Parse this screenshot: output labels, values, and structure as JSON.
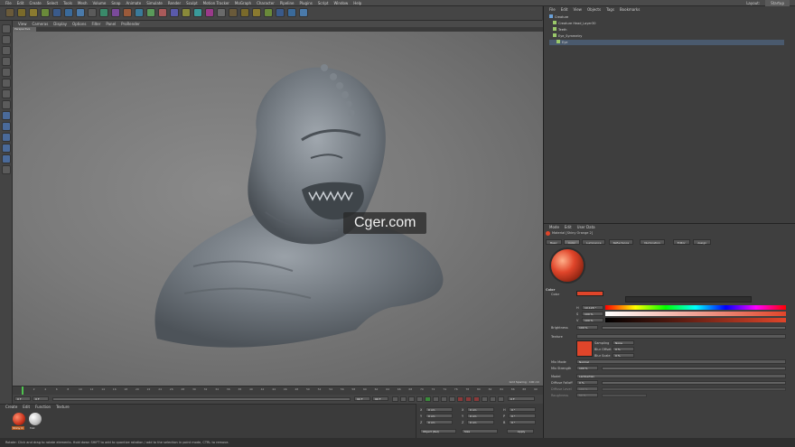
{
  "menubar": {
    "items": [
      "File",
      "Edit",
      "Create",
      "Select",
      "Tools",
      "Mesh",
      "Volume",
      "Snap",
      "Animate",
      "Simulate",
      "Render",
      "Sculpt",
      "Motion Tracker",
      "MoGraph",
      "Character",
      "Pipeline",
      "Plugins",
      "Script",
      "Window",
      "Help"
    ],
    "layout_label": "Layout:",
    "layout_value": "Startup"
  },
  "viewport": {
    "menu": [
      "View",
      "Cameras",
      "Display",
      "Options",
      "Filter",
      "Panel",
      "ProRender"
    ],
    "tag": "Perspective",
    "grid_spacing": "Grid Spacing : 100 cm",
    "watermark": "Cger.com"
  },
  "timeline": {
    "ticks": [
      "0",
      "2",
      "4",
      "6",
      "8",
      "10",
      "12",
      "14",
      "16",
      "18",
      "20",
      "22",
      "24",
      "26",
      "28",
      "30",
      "32",
      "34",
      "36",
      "38",
      "40",
      "42",
      "44",
      "46",
      "48",
      "50",
      "52",
      "54",
      "56",
      "58",
      "60",
      "62",
      "64",
      "66",
      "68",
      "70",
      "72",
      "74",
      "76",
      "78",
      "80",
      "82",
      "84",
      "86",
      "88",
      "90"
    ],
    "current": "0 F",
    "start": "0 F",
    "end": "90 F",
    "end2": "90 F",
    "right_field": "0 F"
  },
  "material_manager": {
    "menu": [
      "Create",
      "Edit",
      "Function",
      "Texture"
    ],
    "materials": [
      "Shiny O",
      "Mat"
    ]
  },
  "coordinates": {
    "rows": [
      {
        "a": "X",
        "av": "0 cm",
        "b": "X",
        "bv": "0 cm",
        "c": "H",
        "cv": "0 °"
      },
      {
        "a": "Y",
        "av": "0 cm",
        "b": "Y",
        "bv": "0 cm",
        "c": "P",
        "cv": "0 °"
      },
      {
        "a": "Z",
        "av": "0 cm",
        "b": "Z",
        "bv": "0 cm",
        "c": "B",
        "cv": "0 °"
      }
    ],
    "mode": "Object (Rel)",
    "size_mode": "Size",
    "apply": "Apply"
  },
  "object_manager": {
    "menu": [
      "File",
      "Edit",
      "View",
      "Objects",
      "Tags",
      "Bookmarks"
    ],
    "rows": [
      "Creature",
      "Creature Head_Layer30",
      "Teeth",
      "Eye_Symmetry",
      "Eye"
    ]
  },
  "attribute_manager": {
    "menu": [
      "Mode",
      "Edit",
      "User Data"
    ],
    "title": "Material [Shiny Orange 2]",
    "tabs": [
      "Basic",
      "Color",
      "Luminance",
      "Reflectance",
      "Illumination",
      "Editor",
      "Assign"
    ],
    "section": "Color",
    "color_label": "Color",
    "h_label": "H",
    "h_value": "10.128 °",
    "s_label": "S",
    "s_value": "100 %",
    "v_label": "V",
    "v_value": "100 %",
    "brightness_label": "Brightness",
    "brightness_value": "100 %",
    "texture_label": "Texture",
    "texture_value": "",
    "sampling_label": "Sampling",
    "sampling_value": "None",
    "blur_offset_label": "Blur Offset",
    "blur_offset_value": "0 %",
    "blur_scale_label": "Blur Scale",
    "blur_scale_value": "0 %",
    "mix_mode_label": "Mix Mode",
    "mix_mode_value": "Normal",
    "mix_strength_label": "Mix Strength",
    "mix_strength_value": "100 %",
    "model_label": "Model",
    "model_value": "Lambertian",
    "diffuse_falloff_label": "Diffuse Falloff",
    "diffuse_falloff_value": "0 %",
    "diffuse_level_label": "Diffuse Level",
    "diffuse_level_value": "100 %",
    "roughness_label": "Roughness",
    "roughness_value": "50 %",
    "filter_label": "Filter",
    "color_swatch": "#e0452a"
  },
  "status": {
    "text": "Rotate: Click and drag to rotate elements. Hold down SHIFT to add to quantize rotation / add to the selection in point mode, CTRL to remove."
  },
  "colors": {
    "accent": "#e0452a",
    "background": "#3a3a3a"
  }
}
